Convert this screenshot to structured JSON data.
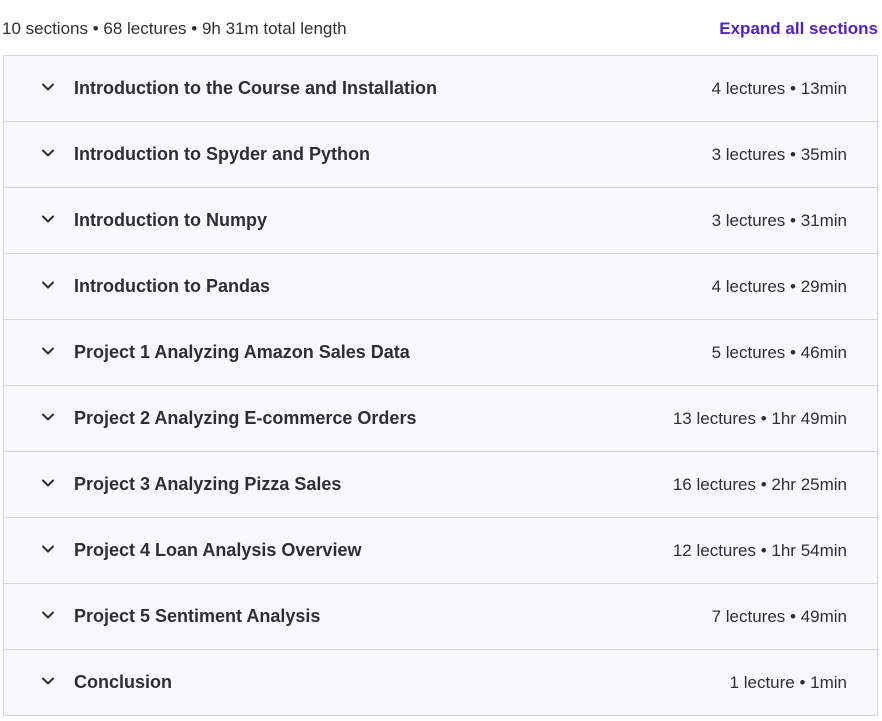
{
  "summary": {
    "text": "10 sections • 68 lectures • 9h 31m total length",
    "expand_label": "Expand all sections"
  },
  "colors": {
    "link": "#5022c3",
    "row_background": "#f7f9fa",
    "border": "#d1d7dc",
    "text": "#2d2f31"
  },
  "sections": [
    {
      "title": "Introduction to the Course and Installation",
      "meta": "4 lectures • 13min",
      "icon": "chevron-down-icon"
    },
    {
      "title": "Introduction to Spyder and Python",
      "meta": "3 lectures • 35min",
      "icon": "chevron-down-icon"
    },
    {
      "title": "Introduction to Numpy",
      "meta": "3 lectures • 31min",
      "icon": "chevron-down-icon"
    },
    {
      "title": "Introduction to Pandas",
      "meta": "4 lectures • 29min",
      "icon": "chevron-down-icon"
    },
    {
      "title": "Project 1 Analyzing Amazon Sales Data",
      "meta": "5 lectures • 46min",
      "icon": "chevron-down-icon"
    },
    {
      "title": "Project 2 Analyzing E-commerce Orders",
      "meta": "13 lectures • 1hr 49min",
      "icon": "chevron-down-icon"
    },
    {
      "title": "Project 3 Analyzing Pizza Sales",
      "meta": "16 lectures • 2hr 25min",
      "icon": "chevron-down-icon"
    },
    {
      "title": "Project 4 Loan Analysis Overview",
      "meta": "12 lectures • 1hr 54min",
      "icon": "chevron-down-icon"
    },
    {
      "title": "Project 5 Sentiment Analysis",
      "meta": "7 lectures • 49min",
      "icon": "chevron-down-icon"
    },
    {
      "title": "Conclusion",
      "meta": "1 lecture • 1min",
      "icon": "chevron-down-icon"
    }
  ]
}
